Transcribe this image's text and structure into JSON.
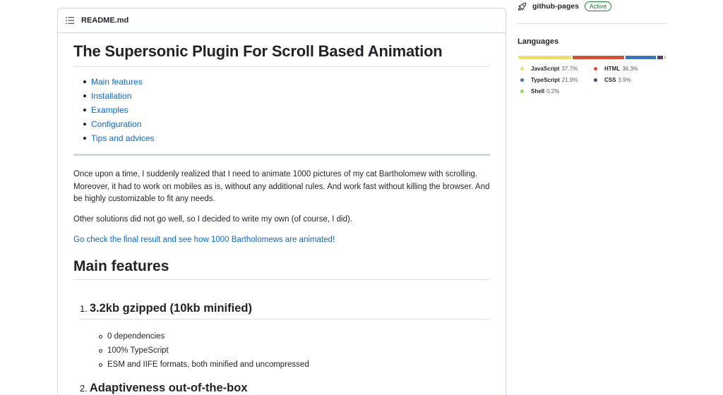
{
  "readme": {
    "filename": "README.md",
    "title": "The Supersonic Plugin For Scroll Based Animation",
    "toc": [
      "Main features",
      "Installation",
      "Examples",
      "Configuration",
      "Tips and advices"
    ],
    "paragraphs": [
      "Once upon a time, I suddenly realized that I need to animate 1000 pictures of my cat Bartholomew with scrolling. Moreover, it had to work on mobiles as is, without any additional rules. And work fast without killing the browser. And be highly customizable to fit any needs.",
      "Other solutions did not go well, so I decided to write my own (of course, I did)."
    ],
    "result_link": "Go check the final result and see how 1000 Bartholomews are animated!",
    "main_features_heading": "Main features",
    "features": [
      {
        "num": "1.",
        "title": "3.2kb gzipped (10kb minified)"
      },
      {
        "num": "2.",
        "title": "Adaptiveness out-of-the-box"
      }
    ],
    "feature1_items": [
      "0 dependencies",
      "100% TypeScript",
      "ESM and IIFE formats, both minified and uncompressed"
    ]
  },
  "sidebar": {
    "deployment_name": "github-pages",
    "deployment_status": "Active",
    "languages_title": "Languages",
    "languages": [
      {
        "name": "JavaScript",
        "percent": "37.7%",
        "value": 37.7,
        "color": "#f1e05a"
      },
      {
        "name": "HTML",
        "percent": "36.3%",
        "value": 36.3,
        "color": "#e34c26"
      },
      {
        "name": "TypeScript",
        "percent": "21.9%",
        "value": 21.9,
        "color": "#3178c6"
      },
      {
        "name": "CSS",
        "percent": "3.9%",
        "value": 3.9,
        "color": "#563d7c"
      },
      {
        "name": "Shell",
        "percent": "0.2%",
        "value": 0.2,
        "color": "#89e051"
      }
    ]
  }
}
